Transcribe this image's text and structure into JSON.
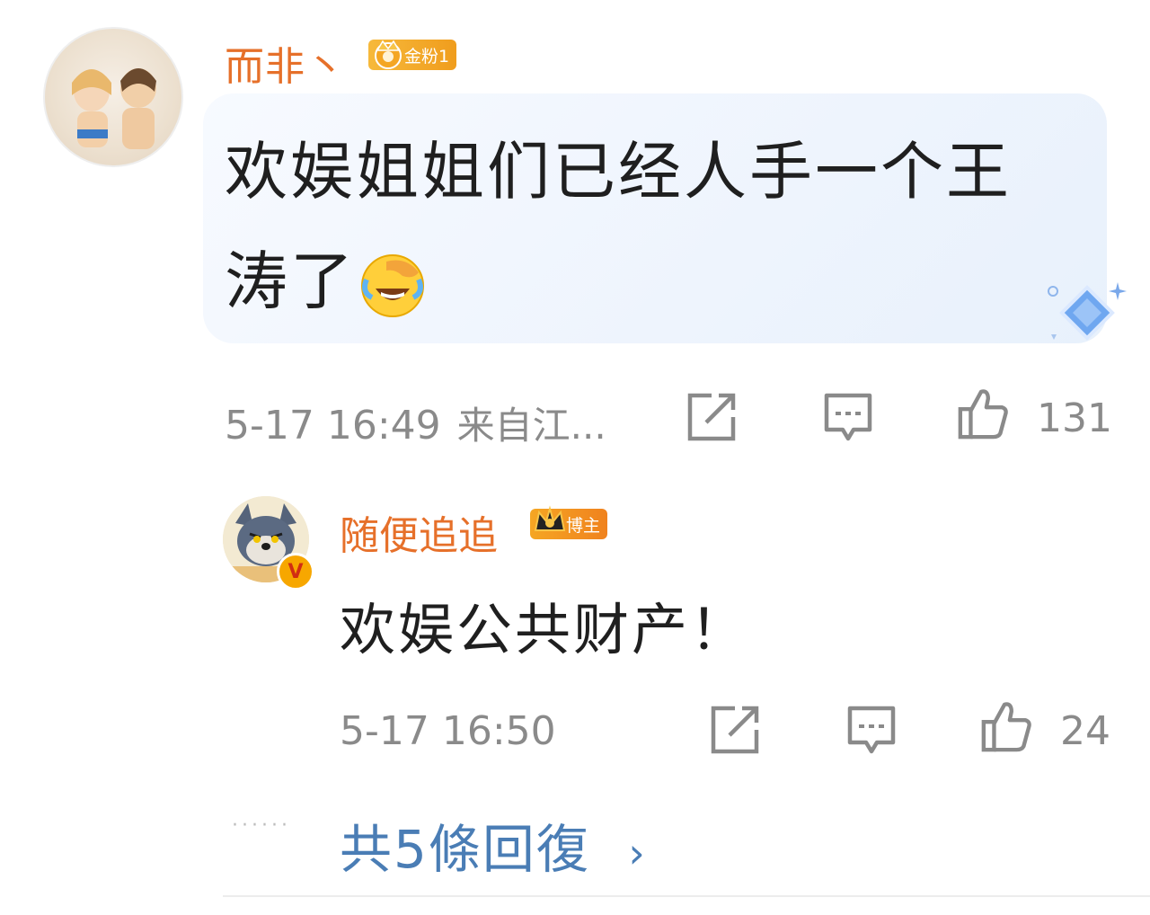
{
  "main_comment": {
    "username": "而非丶",
    "badge": "金粉1",
    "text_line1": "欢娱姐姐们已经人手一个王",
    "text_line2": "涛了",
    "emoji": "laughing-crying-emoji",
    "time": "5-17 16:49",
    "location": "来自江...",
    "likes": "131"
  },
  "reply": {
    "username": "随便追追",
    "badge": "博主",
    "verified": "V",
    "text": "欢娱公共财产！",
    "time": "5-17 16:50",
    "likes": "24"
  },
  "more_replies": {
    "dots": "······",
    "label": "共5條回復",
    "chevron": "›"
  },
  "colors": {
    "username": "#e6702a",
    "link": "#4a7db5",
    "meta": "#8a8a8a",
    "bubble": "#eef4fd"
  }
}
